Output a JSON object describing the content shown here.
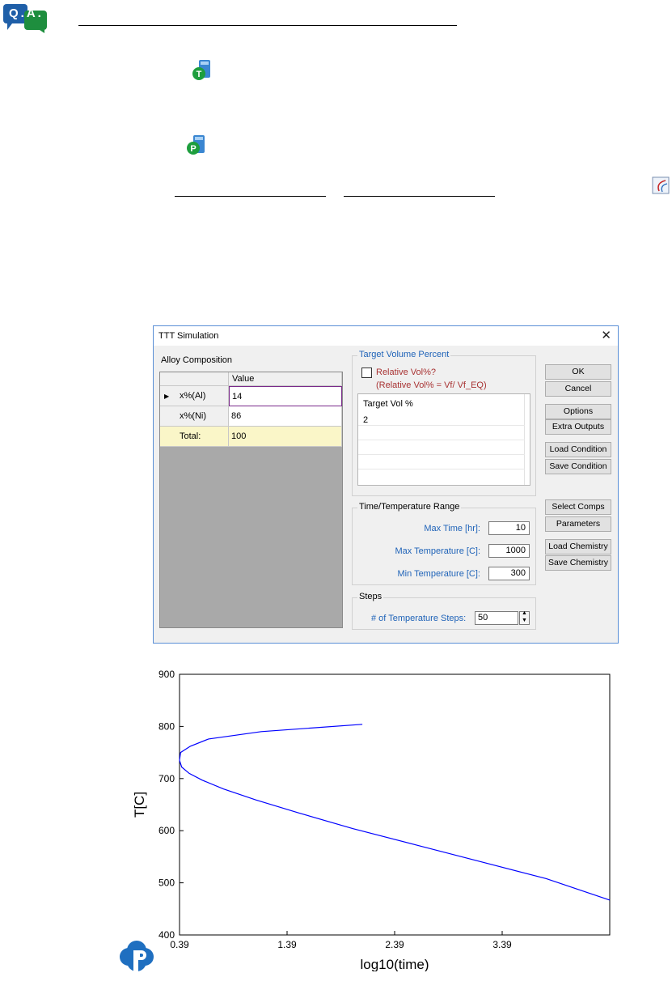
{
  "doc": {
    "qa_badge": "Q.A."
  },
  "dialog": {
    "title": "TTT Simulation",
    "close_glyph": "✕",
    "alloy_composition": {
      "label": "Alloy Composition",
      "column_header": "Value",
      "rows": [
        {
          "name": "x%(Al)",
          "value": "14"
        },
        {
          "name": "x%(Ni)",
          "value": "86"
        }
      ],
      "total_label": "Total:",
      "total_value": "100"
    },
    "target_volume": {
      "label": "Target Volume Percent",
      "checkbox_label": "Relative Vol%?",
      "formula": "(Relative Vol% = Vf/ Vf_EQ)",
      "list_header": "Target Vol %",
      "list_values": [
        "2"
      ]
    },
    "time_temp": {
      "label": "Time/Temperature Range",
      "max_time_label": "Max Time [hr]:",
      "max_time": "10",
      "max_temp_label": "Max Temperature [C]:",
      "max_temp": "1000",
      "min_temp_label": "Min Temperature [C]:",
      "min_temp": "300"
    },
    "steps": {
      "label": "Steps",
      "temp_steps_label": "# of Temperature Steps:",
      "temp_steps": "50"
    },
    "buttons": {
      "ok": "OK",
      "cancel": "Cancel",
      "options": "Options",
      "extra_outputs": "Extra Outputs",
      "load_condition": "Load Condition",
      "save_condition": "Save Condition",
      "select_comps": "Select Comps",
      "parameters": "Parameters",
      "load_chemistry": "Load Chemistry",
      "save_chemistry": "Save Chemistry"
    }
  },
  "chart_data": {
    "type": "line",
    "xlabel": "log10(time)",
    "ylabel": "T[C]",
    "xlim": [
      0.39,
      4.39
    ],
    "ylim": [
      400,
      900
    ],
    "xticks": [
      "0.39",
      "1.39",
      "2.39",
      "3.39"
    ],
    "yticks": [
      "400",
      "500",
      "600",
      "700",
      "800",
      "900"
    ],
    "grid": false,
    "series": [
      {
        "color": "#0000ff",
        "x": [
          2.09,
          1.15,
          0.66,
          0.49,
          0.4,
          0.39,
          0.41,
          0.48,
          0.6,
          0.8,
          1.1,
          1.5,
          2.0,
          2.6,
          3.2,
          3.8,
          4.39
        ],
        "y": [
          804,
          790,
          776,
          762,
          750,
          735,
          722,
          710,
          697,
          680,
          659,
          634,
          604,
          572,
          540,
          508,
          467
        ]
      }
    ],
    "colors": {
      "line": "#0000ff"
    }
  }
}
